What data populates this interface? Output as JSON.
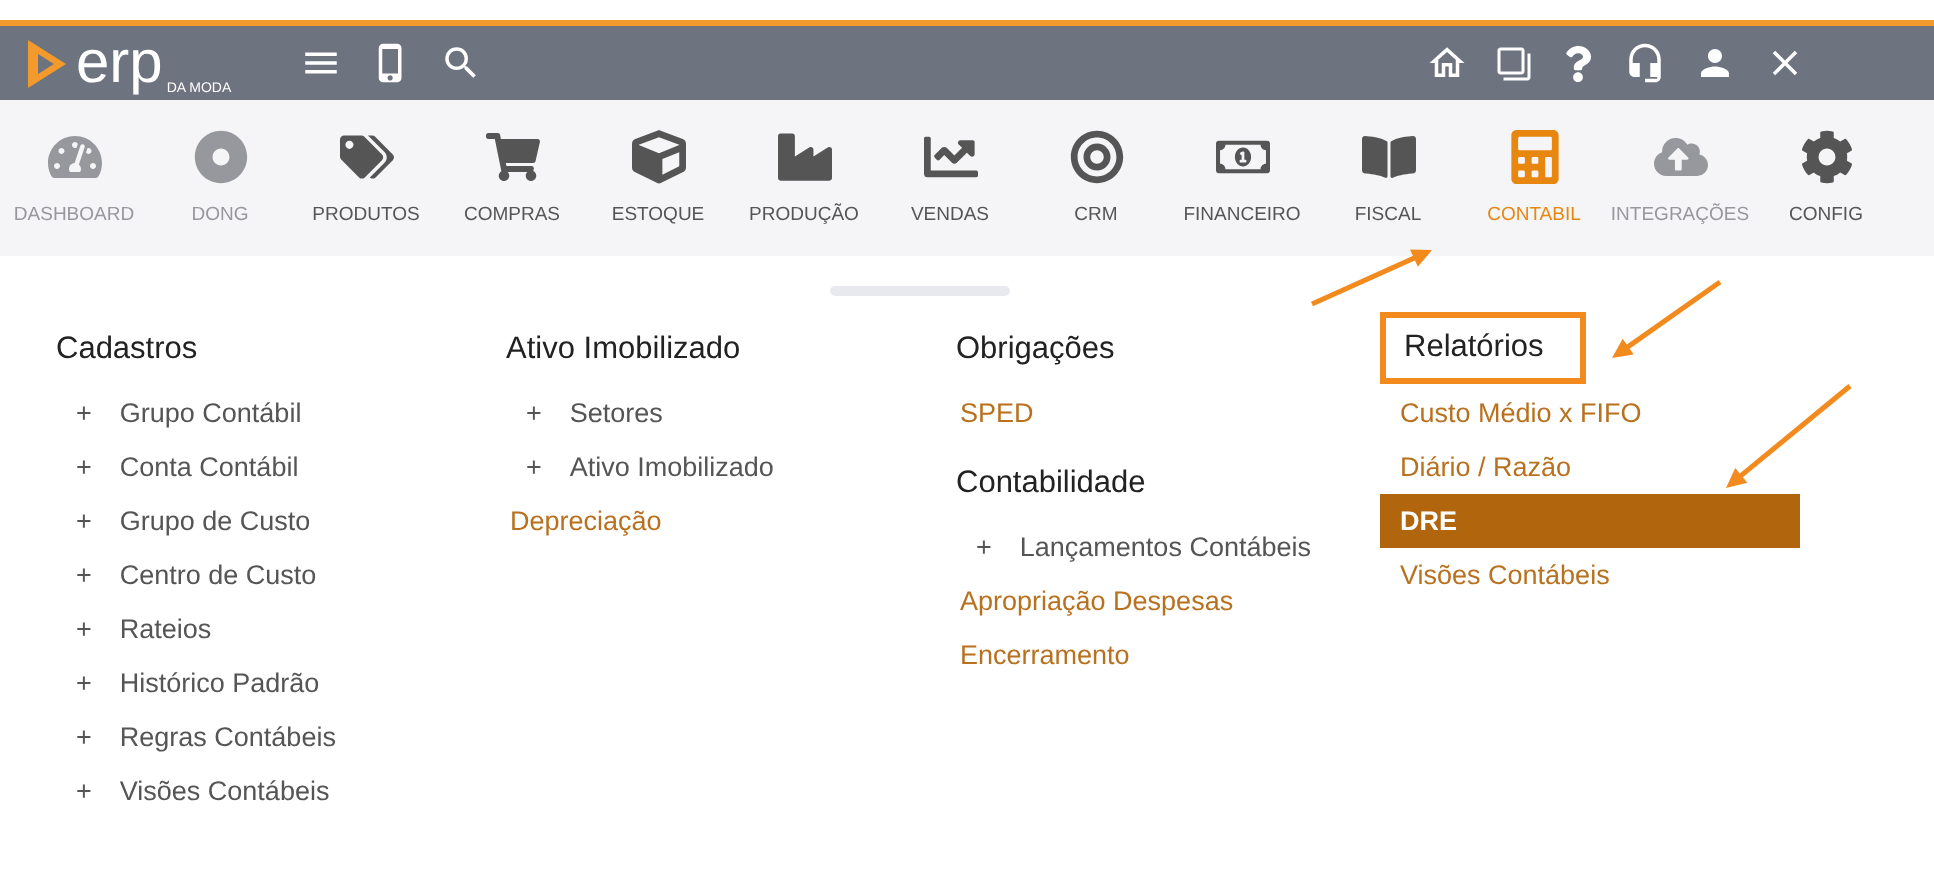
{
  "logo": {
    "name": "erp",
    "tagline": "DA MODA"
  },
  "modules": [
    {
      "label": "DASHBOARD",
      "selected": false,
      "disabled": true
    },
    {
      "label": "DONG",
      "selected": false,
      "disabled": true
    },
    {
      "label": "PRODUTOS",
      "selected": false,
      "disabled": false
    },
    {
      "label": "COMPRAS",
      "selected": false,
      "disabled": false
    },
    {
      "label": "ESTOQUE",
      "selected": false,
      "disabled": false
    },
    {
      "label": "PRODUÇÃO",
      "selected": false,
      "disabled": false
    },
    {
      "label": "VENDAS",
      "selected": false,
      "disabled": false
    },
    {
      "label": "CRM",
      "selected": false,
      "disabled": false
    },
    {
      "label": "FINANCEIRO",
      "selected": false,
      "disabled": false
    },
    {
      "label": "FISCAL",
      "selected": false,
      "disabled": false
    },
    {
      "label": "CONTABIL",
      "selected": true,
      "disabled": false
    },
    {
      "label": "INTEGRAÇÕES",
      "selected": false,
      "disabled": true
    },
    {
      "label": "CONFIG",
      "selected": false,
      "disabled": false
    }
  ],
  "columns": [
    {
      "sections": [
        {
          "title": "Cadastros",
          "boxed": false,
          "items": [
            {
              "label": "Grupo Contábil",
              "kind": "expandable",
              "prefix": "+",
              "selected": false
            },
            {
              "label": "Conta Contábil",
              "kind": "expandable",
              "prefix": "+",
              "selected": false
            },
            {
              "label": "Grupo de Custo",
              "kind": "expandable",
              "prefix": "+",
              "selected": false
            },
            {
              "label": "Centro de Custo",
              "kind": "expandable",
              "prefix": "+",
              "selected": false
            },
            {
              "label": "Rateios",
              "kind": "expandable",
              "prefix": "+",
              "selected": false
            },
            {
              "label": "Histórico Padrão",
              "kind": "expandable",
              "prefix": "+",
              "selected": false
            },
            {
              "label": "Regras Contábeis",
              "kind": "expandable",
              "prefix": "+",
              "selected": false
            },
            {
              "label": "Visões Contábeis",
              "kind": "expandable",
              "prefix": "+",
              "selected": false
            }
          ]
        }
      ]
    },
    {
      "sections": [
        {
          "title": "Ativo Imobilizado",
          "boxed": false,
          "items": [
            {
              "label": "Setores",
              "kind": "expandable",
              "prefix": "+",
              "selected": false
            },
            {
              "label": "Ativo Imobilizado",
              "kind": "expandable",
              "prefix": "+",
              "selected": false
            },
            {
              "label": "Depreciação",
              "kind": "link",
              "selected": false
            }
          ]
        }
      ]
    },
    {
      "sections": [
        {
          "title": "Obrigações",
          "boxed": false,
          "items": [
            {
              "label": "SPED",
              "kind": "link",
              "selected": false
            }
          ]
        },
        {
          "title": "Contabilidade",
          "boxed": false,
          "items": [
            {
              "label": "Lançamentos Contábeis",
              "kind": "expandable",
              "prefix": "+",
              "selected": false
            },
            {
              "label": "Apropriação Despesas",
              "kind": "link",
              "selected": false
            },
            {
              "label": "Encerramento",
              "kind": "link",
              "selected": false
            }
          ]
        }
      ]
    },
    {
      "sections": [
        {
          "title": "Relatórios",
          "boxed": true,
          "items": [
            {
              "label": "Custo Médio x FIFO",
              "kind": "link",
              "selected": false
            },
            {
              "label": "Diário / Razão",
              "kind": "link",
              "selected": false
            },
            {
              "label": "DRE",
              "kind": "link",
              "selected": true
            },
            {
              "label": "Visões Contábeis",
              "kind": "link",
              "selected": false
            }
          ]
        }
      ]
    }
  ]
}
